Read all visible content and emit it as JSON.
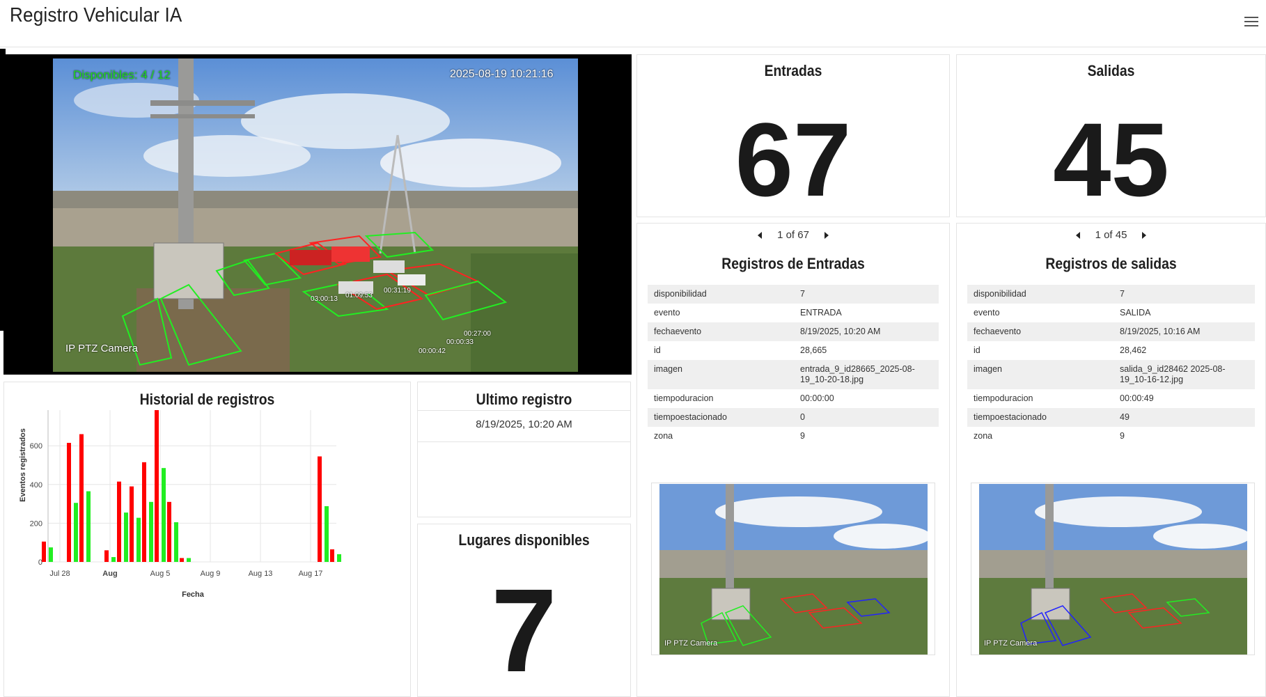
{
  "app": {
    "title": "Registro Vehicular IA"
  },
  "camera": {
    "overlay_disponibles": "Disponibles: 4 / 12",
    "overlay_timestamp": "2025-08-19 10:21:16",
    "overlay_label": "IP PTZ Camera",
    "timer_labels": [
      "03:00:13",
      "01:09:53",
      "00:31:19",
      "00:27:00",
      "00:00:33",
      "00:00:42"
    ]
  },
  "entradas": {
    "title": "Entradas",
    "value": "67"
  },
  "salidas": {
    "title": "Salidas",
    "value": "45"
  },
  "registros_entradas": {
    "pager": "1 of 67",
    "title": "Registros de Entradas",
    "rows": [
      {
        "k": "disponibilidad",
        "v": "7"
      },
      {
        "k": "evento",
        "v": "ENTRADA"
      },
      {
        "k": "fechaevento",
        "v": "8/19/2025, 10:20 AM"
      },
      {
        "k": "id",
        "v": "28,665"
      },
      {
        "k": "imagen",
        "v": "entrada_9_id28665_2025-08-19_10-20-18.jpg"
      },
      {
        "k": "tiempoduracion",
        "v": "00:00:00"
      },
      {
        "k": "tiempoestacionado",
        "v": "0"
      },
      {
        "k": "zona",
        "v": "9"
      }
    ],
    "thumb_label": "IP PTZ Camera"
  },
  "registros_salidas": {
    "pager": "1 of 45",
    "title": "Registros de salidas",
    "rows": [
      {
        "k": "disponibilidad",
        "v": "7"
      },
      {
        "k": "evento",
        "v": "SALIDA"
      },
      {
        "k": "fechaevento",
        "v": "8/19/2025, 10:16 AM"
      },
      {
        "k": "id",
        "v": "28,462"
      },
      {
        "k": "imagen",
        "v": "salida_9_id28462 2025-08-19_10-16-12.jpg"
      },
      {
        "k": "tiempoduracion",
        "v": "00:00:49"
      },
      {
        "k": "tiempoestacionado",
        "v": "49"
      },
      {
        "k": "zona",
        "v": "9"
      }
    ],
    "thumb_label": "IP PTZ Camera"
  },
  "ultimo": {
    "title": "Ultimo registro",
    "value": "8/19/2025, 10:20 AM"
  },
  "lugares": {
    "title": "Lugares disponibles",
    "value": "7"
  },
  "historial": {
    "title": "Historial de registros"
  },
  "colors": {
    "entrada": "#ff0000",
    "salida": "#22ee22",
    "grid": "#e6e6e6"
  },
  "chart_data": {
    "type": "bar",
    "title": "Historial de registros",
    "xlabel": "Fecha",
    "ylabel": "Eventos registrados",
    "ylim": [
      0,
      1000
    ],
    "y_ticks": [
      "0",
      "200",
      "400",
      "600",
      "800",
      "1k"
    ],
    "x_ticks": [
      {
        "label": "Jul 28",
        "day": 0,
        "bold": false
      },
      {
        "label": "Aug",
        "day": 4,
        "bold": true
      },
      {
        "label": "Aug 5",
        "day": 8,
        "bold": false
      },
      {
        "label": "Aug 9",
        "day": 12,
        "bold": false
      },
      {
        "label": "Aug 13",
        "day": 16,
        "bold": false
      },
      {
        "label": "Aug 17",
        "day": 20,
        "bold": false
      }
    ],
    "series": [
      {
        "values": [
          [
            -1,
            105
          ],
          [
            1,
            615
          ],
          [
            2,
            660
          ],
          [
            4,
            60
          ],
          [
            5,
            415
          ],
          [
            6,
            390
          ],
          [
            7,
            515
          ],
          [
            8,
            915
          ],
          [
            9,
            310
          ],
          [
            10,
            20
          ],
          [
            21,
            545
          ],
          [
            22,
            65
          ]
        ]
      },
      {
        "values": [
          [
            -1,
            75
          ],
          [
            1,
            305
          ],
          [
            2,
            365
          ],
          [
            4,
            25
          ],
          [
            5,
            255
          ],
          [
            6,
            228
          ],
          [
            7,
            310
          ],
          [
            8,
            485
          ],
          [
            9,
            205
          ],
          [
            10,
            20
          ],
          [
            21,
            288
          ],
          [
            22,
            40
          ]
        ]
      }
    ]
  }
}
